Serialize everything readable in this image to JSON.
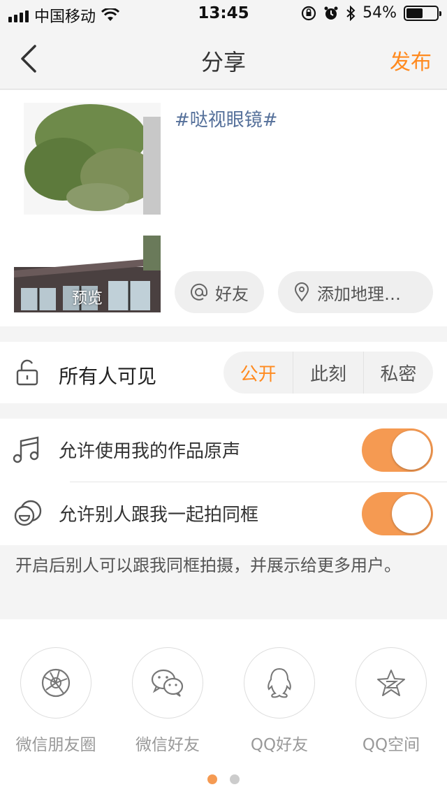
{
  "status_bar": {
    "carrier": "中国移动",
    "time": "13:45",
    "battery": "54%",
    "battery_level": 0.54
  },
  "nav": {
    "title": "分享",
    "publish": "发布"
  },
  "compose": {
    "caption": "#哒视眼镜#",
    "preview_label": "预览",
    "friends_chip": "好友",
    "location_chip": "添加地理…"
  },
  "visibility": {
    "label": "所有人可见",
    "options": [
      "公开",
      "此刻",
      "私密"
    ],
    "selected": "公开"
  },
  "toggles": [
    {
      "label": "允许使用我的作品原声",
      "on": true
    },
    {
      "label": "允许别人跟我一起拍同框",
      "on": true
    }
  ],
  "hint": "开启后别人可以跟我同框拍摄，并展示给更多用户。",
  "share_targets": [
    {
      "name": "微信朋友圈",
      "icon": "aperture-icon"
    },
    {
      "name": "微信好友",
      "icon": "wechat-icon"
    },
    {
      "name": "QQ好友",
      "icon": "qq-icon"
    },
    {
      "name": "QQ空间",
      "icon": "qzone-star-icon"
    }
  ],
  "pager": {
    "pages": 2,
    "active": 0
  },
  "colors": {
    "accent": "#ff8a1f",
    "toggle_on": "#f59a52",
    "hashtag": "#55709a"
  }
}
